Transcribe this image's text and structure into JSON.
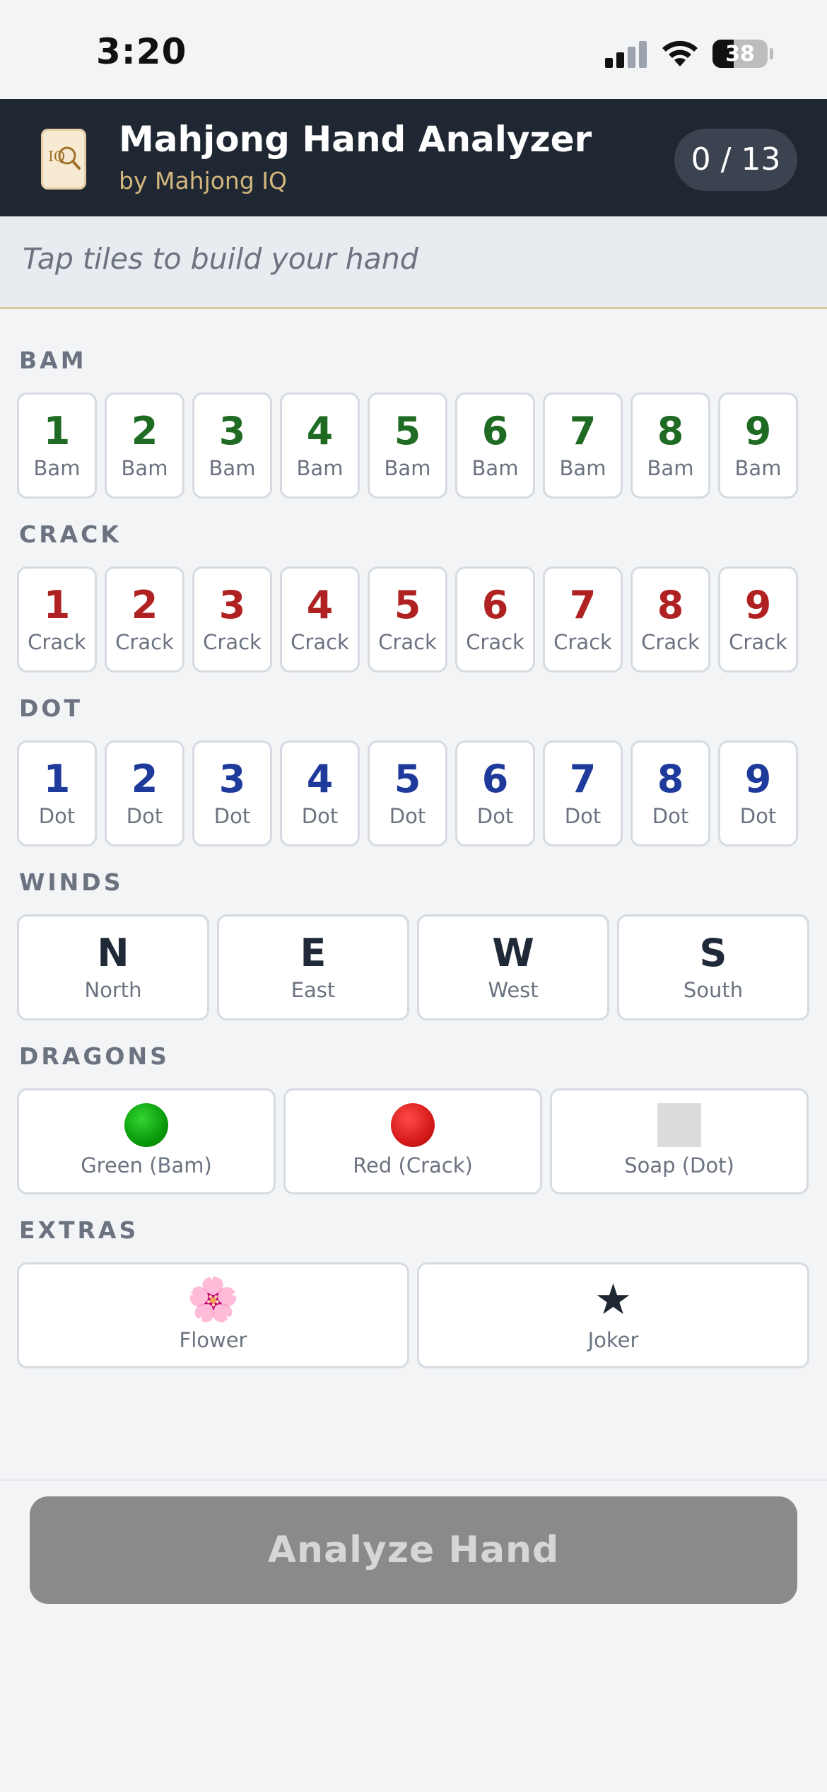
{
  "status_bar": {
    "time": "3:20",
    "battery": "38",
    "battery_level": 0.38
  },
  "header": {
    "title": "Mahjong Hand Analyzer",
    "subtitle": "by Mahjong IQ",
    "count": "0 / 13",
    "logo_text": "IQ"
  },
  "hand": {
    "placeholder": "Tap tiles to build your hand"
  },
  "sections": {
    "bam": {
      "label": "BAM",
      "tiles": [
        {
          "num": "1",
          "lbl": "Bam"
        },
        {
          "num": "2",
          "lbl": "Bam"
        },
        {
          "num": "3",
          "lbl": "Bam"
        },
        {
          "num": "4",
          "lbl": "Bam"
        },
        {
          "num": "5",
          "lbl": "Bam"
        },
        {
          "num": "6",
          "lbl": "Bam"
        },
        {
          "num": "7",
          "lbl": "Bam"
        },
        {
          "num": "8",
          "lbl": "Bam"
        },
        {
          "num": "9",
          "lbl": "Bam"
        }
      ]
    },
    "crack": {
      "label": "CRACK",
      "tiles": [
        {
          "num": "1",
          "lbl": "Crack"
        },
        {
          "num": "2",
          "lbl": "Crack"
        },
        {
          "num": "3",
          "lbl": "Crack"
        },
        {
          "num": "4",
          "lbl": "Crack"
        },
        {
          "num": "5",
          "lbl": "Crack"
        },
        {
          "num": "6",
          "lbl": "Crack"
        },
        {
          "num": "7",
          "lbl": "Crack"
        },
        {
          "num": "8",
          "lbl": "Crack"
        },
        {
          "num": "9",
          "lbl": "Crack"
        }
      ]
    },
    "dot": {
      "label": "DOT",
      "tiles": [
        {
          "num": "1",
          "lbl": "Dot"
        },
        {
          "num": "2",
          "lbl": "Dot"
        },
        {
          "num": "3",
          "lbl": "Dot"
        },
        {
          "num": "4",
          "lbl": "Dot"
        },
        {
          "num": "5",
          "lbl": "Dot"
        },
        {
          "num": "6",
          "lbl": "Dot"
        },
        {
          "num": "7",
          "lbl": "Dot"
        },
        {
          "num": "8",
          "lbl": "Dot"
        },
        {
          "num": "9",
          "lbl": "Dot"
        }
      ]
    },
    "winds": {
      "label": "WINDS",
      "tiles": [
        {
          "num": "N",
          "lbl": "North"
        },
        {
          "num": "E",
          "lbl": "East"
        },
        {
          "num": "W",
          "lbl": "West"
        },
        {
          "num": "S",
          "lbl": "South"
        }
      ]
    },
    "dragons": {
      "label": "DRAGONS",
      "tiles": [
        {
          "icon": "green-dragon-icon",
          "lbl": "Green (Bam)"
        },
        {
          "icon": "red-dragon-icon",
          "lbl": "Red (Crack)"
        },
        {
          "icon": "soap-dragon-icon",
          "lbl": "Soap (Dot)"
        }
      ]
    },
    "extras": {
      "label": "EXTRAS",
      "tiles": [
        {
          "icon": "flower-icon",
          "glyph": "🌸",
          "lbl": "Flower"
        },
        {
          "icon": "star-icon",
          "glyph": "★",
          "lbl": "Joker"
        }
      ]
    }
  },
  "footer": {
    "analyze_label": "Analyze Hand"
  },
  "colors": {
    "header_bg": "#1f2733",
    "subtitle": "#d3b77d",
    "bam": "#1f6b24",
    "crack": "#b02222",
    "dot": "#1e3a9a",
    "button_disabled": "#8a8a8a"
  }
}
